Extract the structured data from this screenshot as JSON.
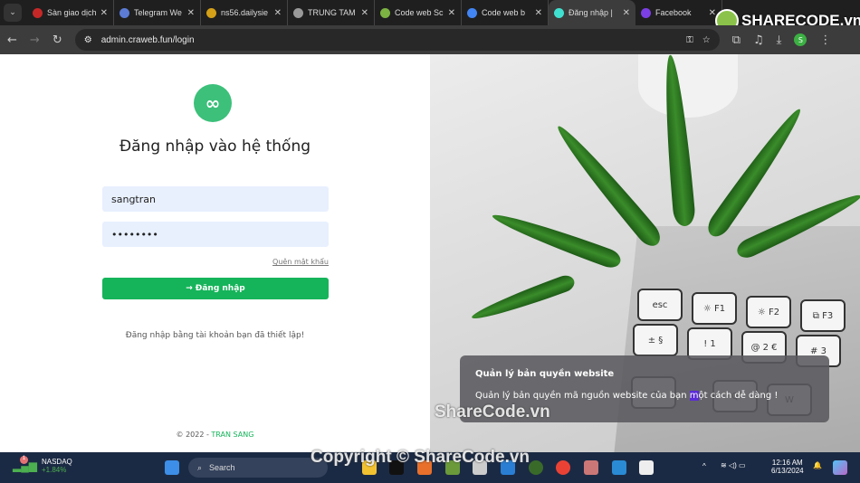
{
  "browser": {
    "tabs": [
      {
        "title": "Sàn giao dịch",
        "color": "#c62828"
      },
      {
        "title": "Telegram We",
        "color": "#5b7bd5"
      },
      {
        "title": "ns56.dailysie",
        "color": "#d4a017"
      },
      {
        "title": "TRUNG TAM",
        "color": "#999999"
      },
      {
        "title": "Code web Sc",
        "color": "#7cb342"
      },
      {
        "title": "Code web b",
        "color": "#4285f4"
      },
      {
        "title": "Đăng nhập |",
        "color": "#40e0d0",
        "active": true
      },
      {
        "title": "Facebook",
        "color": "#7b3fe4"
      }
    ],
    "url": "admin.craweb.fun/login",
    "profile_initial": "S"
  },
  "watermark": {
    "logo": "SHARECODE.vn",
    "mid": "ShareCode.vn",
    "bottom": "Copyright © ShareCode.vn"
  },
  "login": {
    "logo_glyph": "∞",
    "title": "Đăng nhập vào hệ thống",
    "username": "sangtran",
    "password": "••••••••",
    "forgot": "Quên mật khẩu",
    "submit": "Đăng nhập",
    "submit_icon": "→",
    "hint": "Đăng nhập bằng tài khoản bạn đã thiết lập!",
    "footer_prefix": "© 2022 - ",
    "footer_name": "TRAN SANG"
  },
  "notice": {
    "title": "Quản lý bản quyền website",
    "body_pre": "Quản lý bản quyền mã nguồn website của bạn ",
    "body_mark": "m",
    "body_post": "ột cách dễ dàng !"
  },
  "keys": [
    "esc",
    "☼ F1",
    "☼ F2",
    "⧉ F3",
    "± §",
    "! 1",
    "@ 2 €",
    "# 3",
    "⇥",
    "Q",
    "W"
  ],
  "taskbar": {
    "stock_name": "NASDAQ",
    "stock_change": "+1.84%",
    "badge": "1",
    "search": "Search",
    "time": "12:16 AM",
    "date": "6/13/2024"
  }
}
